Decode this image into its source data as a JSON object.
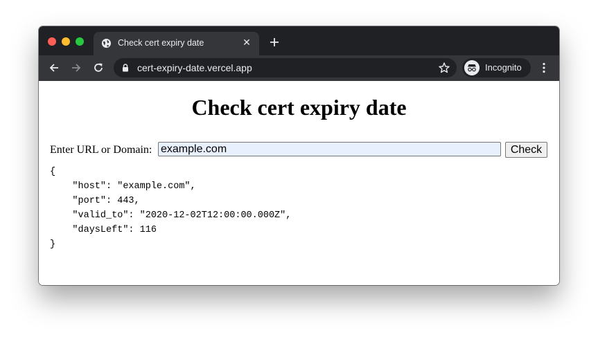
{
  "browser": {
    "tab_title": "Check cert expiry date",
    "url": "cert-expiry-date.vercel.app",
    "profile_label": "Incognito"
  },
  "page": {
    "title": "Check cert expiry date",
    "form_label": "Enter URL or Domain:",
    "input_value": "example.com",
    "button_label": "Check",
    "result_lines": [
      "{",
      "    \"host\": \"example.com\",",
      "    \"port\": 443,",
      "    \"valid_to\": \"2020-12-02T12:00:00.000Z\",",
      "    \"daysLeft\": 116",
      "}"
    ]
  },
  "icons": {
    "favicon": "globe-icon",
    "back": "arrow-left-icon",
    "forward": "arrow-right-icon",
    "reload": "reload-icon",
    "lock": "lock-icon",
    "bookmark": "star-icon",
    "menu": "vertical-dots-icon"
  },
  "colors": {
    "tab_strip": "#202124",
    "toolbar": "#35363a",
    "autofill_input": "#e8f0fe"
  }
}
